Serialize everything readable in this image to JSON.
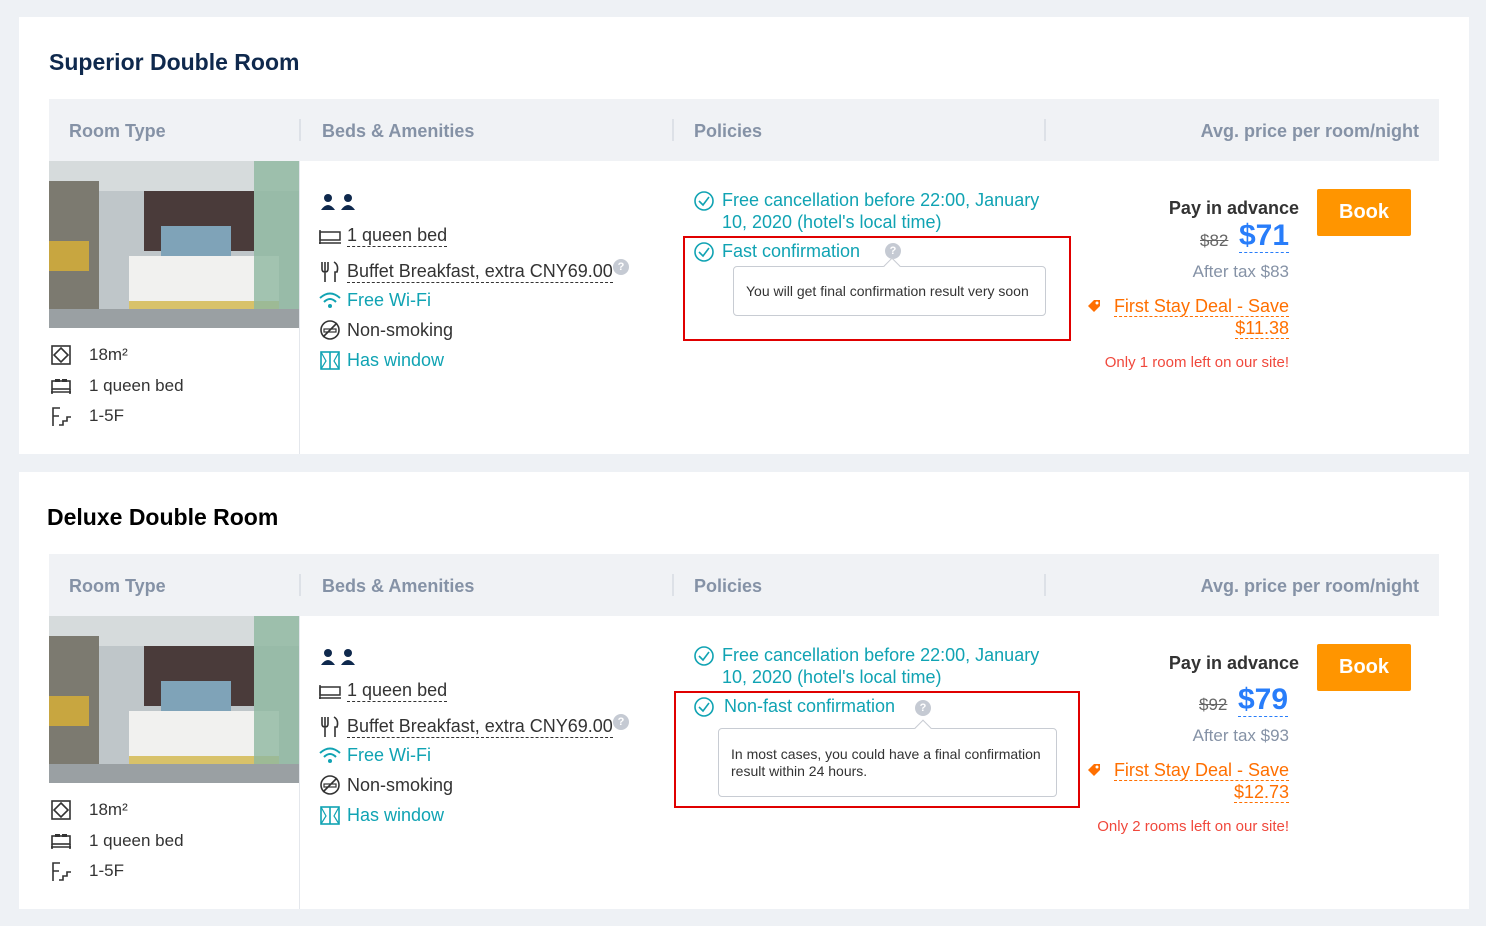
{
  "table_headers": {
    "room_type": "Room Type",
    "beds_amenities": "Beds & Amenities",
    "policies": "Policies",
    "avg_price": "Avg. price per room/night"
  },
  "rooms": [
    {
      "title": "Superior Double Room",
      "specs": {
        "size": "18m²",
        "bed": "1 queen bed",
        "floor": "1-5F"
      },
      "amenities": {
        "bed": "1 queen bed",
        "breakfast": "Buffet Breakfast, extra CNY69.00",
        "wifi": "Free Wi-Fi",
        "smoking": "Non-smoking",
        "window": "Has window"
      },
      "policies": {
        "cancel_line1": "Free cancellation before 22:00, January",
        "cancel_line2": "10, 2020 (hotel's local time)",
        "confirmation": "Fast confirmation",
        "tooltip_line1": "You will get final confirmation result very soon",
        "tooltip_line2": ""
      },
      "price": {
        "pay_label": "Pay in advance",
        "original": "$82",
        "current": "$71",
        "after_tax": "After tax $83",
        "deal_line1": "First Stay Deal - Save",
        "deal_line2": "$11.38",
        "availability": "Only 1 room left on our site!"
      },
      "book_label": "Book"
    },
    {
      "title": "Deluxe Double Room",
      "specs": {
        "size": "18m²",
        "bed": "1 queen bed",
        "floor": "1-5F"
      },
      "amenities": {
        "bed": "1 queen bed",
        "breakfast": "Buffet Breakfast, extra CNY69.00",
        "wifi": "Free Wi-Fi",
        "smoking": "Non-smoking",
        "window": "Has window"
      },
      "policies": {
        "cancel_line1": "Free cancellation before 22:00, January",
        "cancel_line2": "10, 2020 (hotel's local time)",
        "confirmation": "Non-fast confirmation",
        "tooltip_line1": "In most cases, you could have a final confirmation",
        "tooltip_line2": "result within 24 hours."
      },
      "price": {
        "pay_label": "Pay in advance",
        "original": "$92",
        "current": "$79",
        "after_tax": "After tax $93",
        "deal_line1": "First Stay Deal - Save",
        "deal_line2": "$12.73",
        "availability": "Only 2 rooms left on our site!"
      },
      "book_label": "Book"
    }
  ],
  "colors": {
    "accent_teal": "#10a3b3",
    "price_blue": "#287dfa",
    "deal_orange": "#ff6f00",
    "book_button": "#ff9500",
    "highlight_red": "#e00000"
  }
}
